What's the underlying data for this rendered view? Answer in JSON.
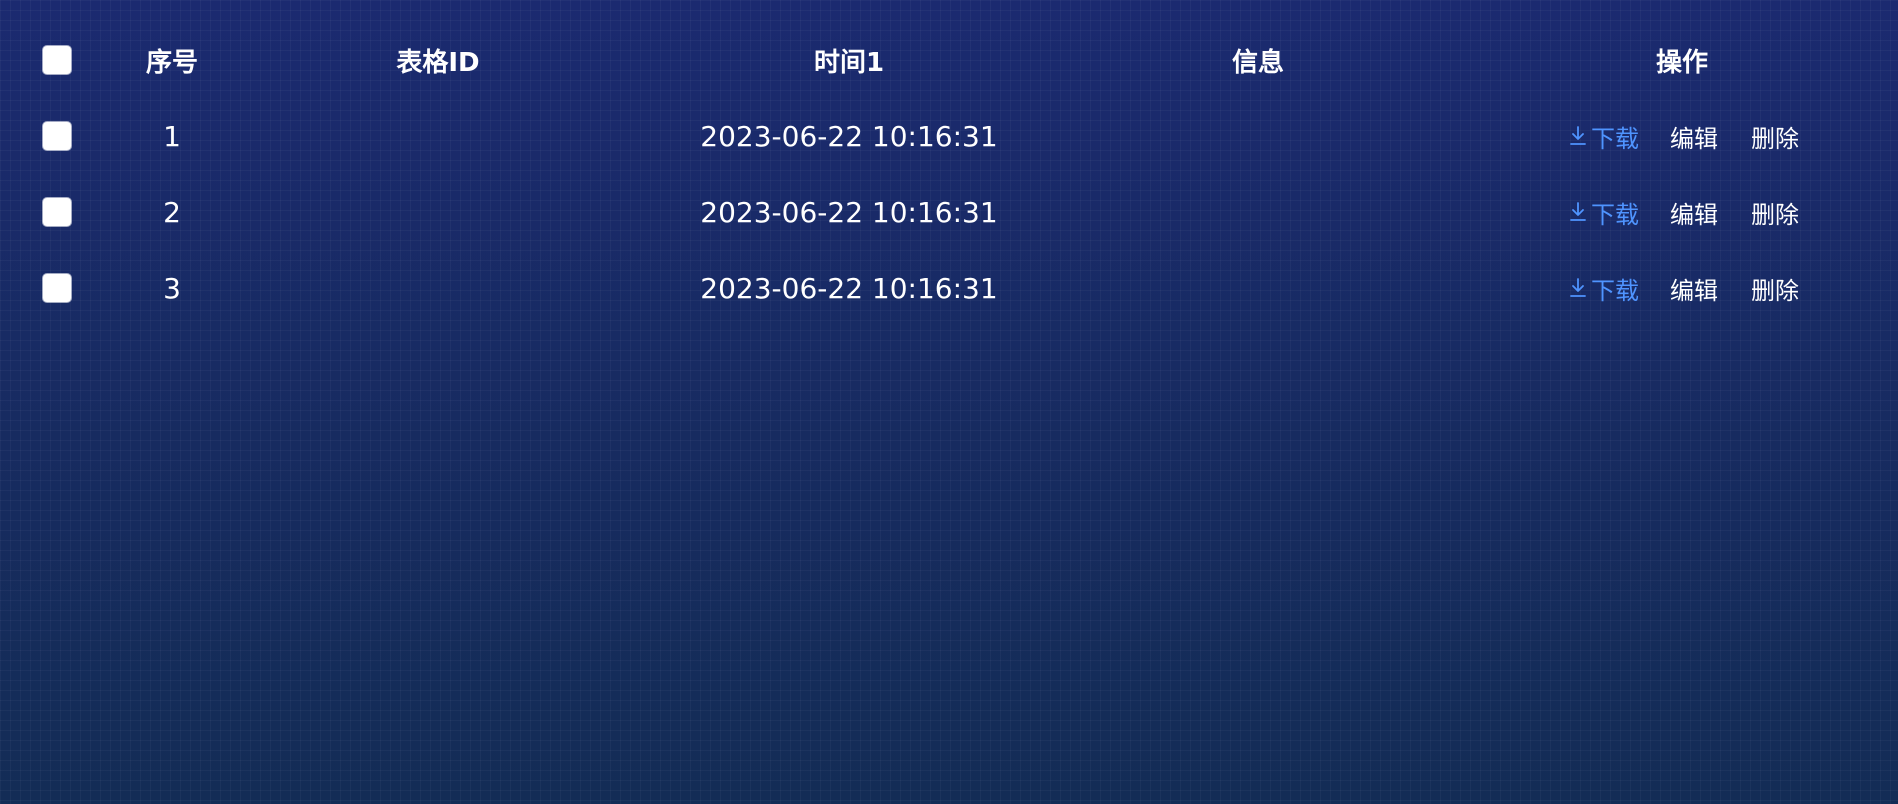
{
  "table": {
    "headers": {
      "index": "序号",
      "table_id": "表格ID",
      "time": "时间1",
      "info": "信息",
      "actions": "操作"
    },
    "rows": [
      {
        "index": "1",
        "table_id": "",
        "time": "2023-06-22 10:16:31",
        "info": "",
        "download": "下载",
        "edit": "编辑",
        "delete": "删除"
      },
      {
        "index": "2",
        "table_id": "",
        "time": "2023-06-22 10:16:31",
        "info": "",
        "download": "下载",
        "edit": "编辑",
        "delete": "删除"
      },
      {
        "index": "3",
        "table_id": "",
        "time": "2023-06-22 10:16:31",
        "info": "",
        "download": "下载",
        "edit": "编辑",
        "delete": "删除"
      }
    ],
    "colors": {
      "download_link": "#4f94ff",
      "text": "#ffffff",
      "background": "#182a63"
    },
    "icons": {
      "download": "download-icon"
    }
  }
}
